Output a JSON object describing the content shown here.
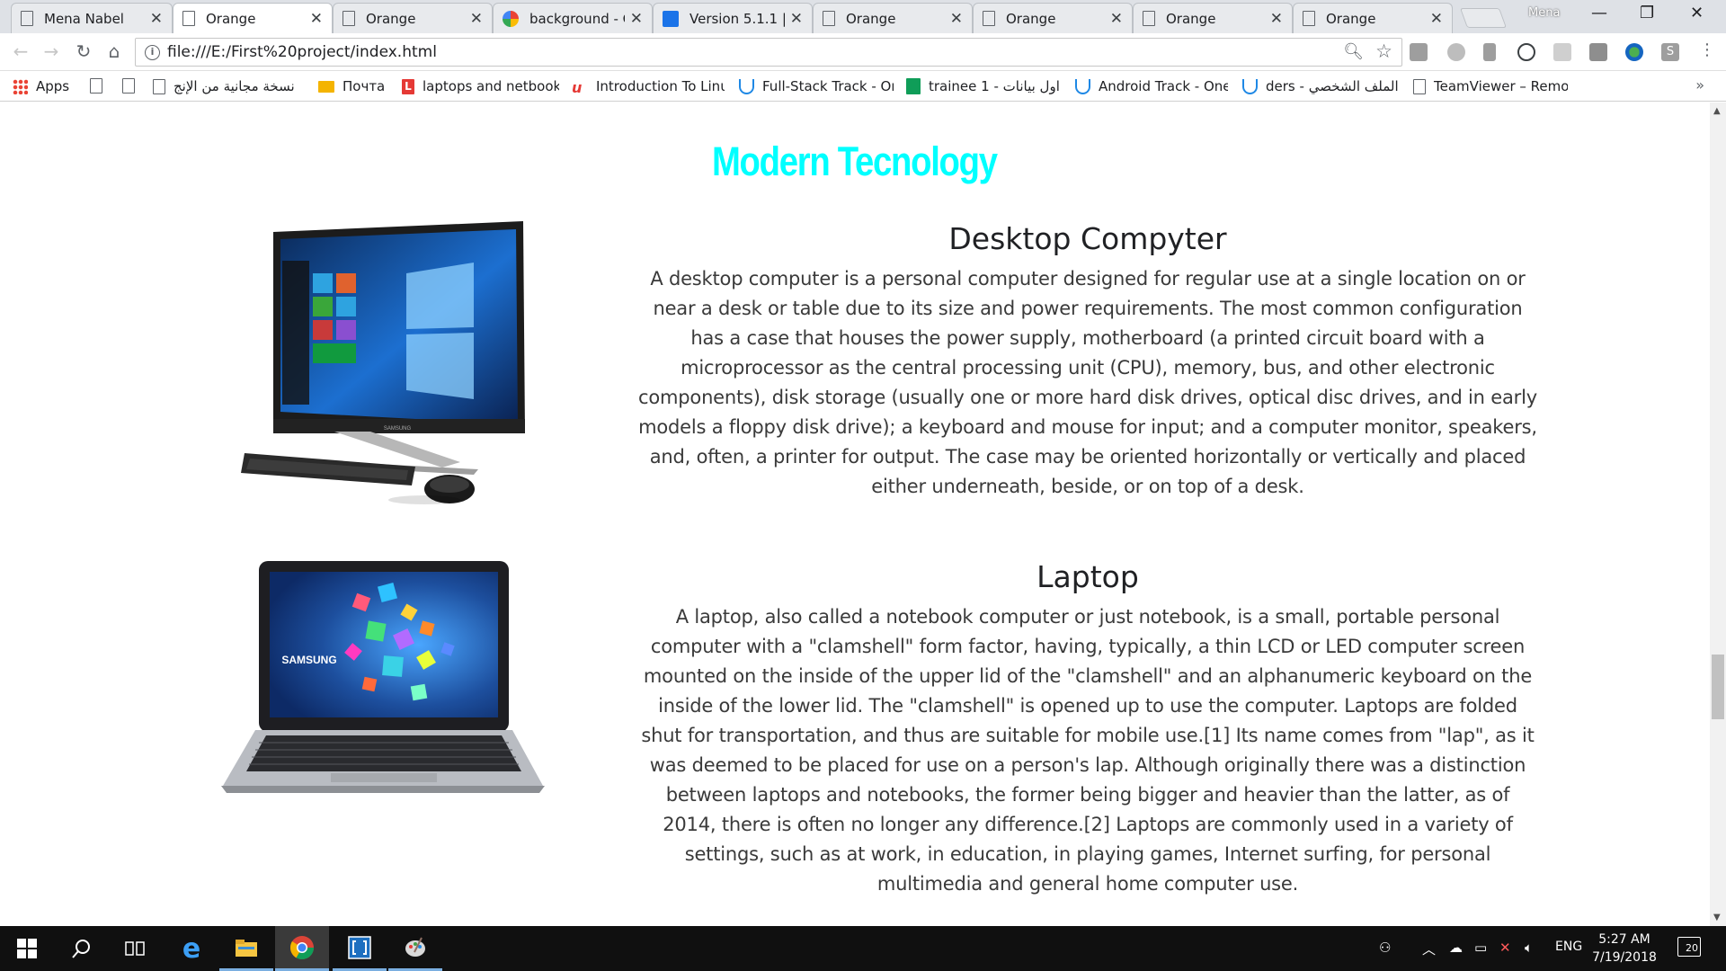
{
  "browser": {
    "tabs": [
      {
        "title": "Mena Nabel",
        "icon": "page-icon"
      },
      {
        "title": "Orange",
        "icon": "page-icon"
      },
      {
        "title": "Orange",
        "icon": "page-icon"
      },
      {
        "title": "background - G",
        "icon": "google-icon"
      },
      {
        "title": "Version 5.1.1 | F",
        "icon": "flag-icon"
      },
      {
        "title": "Orange",
        "icon": "page-icon"
      },
      {
        "title": "Orange",
        "icon": "page-icon"
      },
      {
        "title": "Orange",
        "icon": "page-icon"
      },
      {
        "title": "Orange",
        "icon": "page-icon"
      }
    ],
    "active_tab_index": 1,
    "profile_name": "Mena",
    "window_controls": {
      "minimize": "—",
      "restore": "❐",
      "close": "✕"
    },
    "url": "file:///E:/First%20project/index.html",
    "nav": {
      "back": "←",
      "forward": "→",
      "reload": "↻",
      "home": "⌂"
    },
    "bookmarks": [
      {
        "label": "Apps",
        "icon": "apps-icon"
      },
      {
        "label": "",
        "icon": "page-icon"
      },
      {
        "label": "",
        "icon": "page-icon"
      },
      {
        "label": "نسخة مجانية من الإنج",
        "icon": "page-icon"
      },
      {
        "label": "Почта",
        "icon": "mail-icon"
      },
      {
        "label": "laptops and netbook",
        "icon": "l-icon"
      },
      {
        "label": "Introduction To Linu",
        "icon": "udemy-icon"
      },
      {
        "label": "Full-Stack Track - On",
        "icon": "udacity-icon"
      },
      {
        "label": "trainee 1 - اول بيانات",
        "icon": "sheets-icon"
      },
      {
        "label": "Android Track - One",
        "icon": "udacity-icon"
      },
      {
        "label": "ders - الملف الشخصي",
        "icon": "udacity-icon"
      },
      {
        "label": "TeamViewer – Remo",
        "icon": "page-icon"
      }
    ],
    "bookmarks_more": "»"
  },
  "page": {
    "title": "Modern Tecnology",
    "sections": [
      {
        "heading": "Desktop Compyter",
        "image": "desktop-computer-image",
        "body": "A desktop computer is a personal computer designed for regular use at a single location on or near a desk or table due to its size and power requirements. The most common configuration has a case that houses the power supply, motherboard (a printed circuit board with a microprocessor as the central processing unit (CPU), memory, bus, and other electronic components), disk storage (usually one or more hard disk drives, optical disc drives, and in early models a floppy disk drive); a keyboard and mouse for input; and a computer monitor, speakers, and, often, a printer for output. The case may be oriented horizontally or vertically and placed either underneath, beside, or on top of a desk."
      },
      {
        "heading": "Laptop",
        "image": "laptop-image",
        "image_brand": "SAMSUNG",
        "body": "A laptop, also called a notebook computer or just notebook, is a small, portable personal computer with a \"clamshell\" form factor, having, typically, a thin LCD or LED computer screen mounted on the inside of the upper lid of the \"clamshell\" and an alphanumeric keyboard on the inside of the lower lid. The \"clamshell\" is opened up to use the computer. Laptops are folded shut for transportation, and thus are suitable for mobile use.[1] Its name comes from \"lap\", as it was deemed to be placed for use on a person's lap. Although originally there was a distinction between laptops and notebooks, the former being bigger and heavier than the latter, as of 2014, there is often no longer any difference.[2] Laptops are commonly used in a variety of settings, such as at work, in education, in playing games, Internet surfing, for personal multimedia and general home computer use."
      }
    ]
  },
  "taskbar": {
    "language": "ENG",
    "time": "5:27 AM",
    "date": "7/19/2018",
    "notifications_count": "20"
  },
  "colors": {
    "title_cyan": "#00ffff",
    "taskbar": "#101010",
    "tabstrip": "#dee1e6"
  }
}
